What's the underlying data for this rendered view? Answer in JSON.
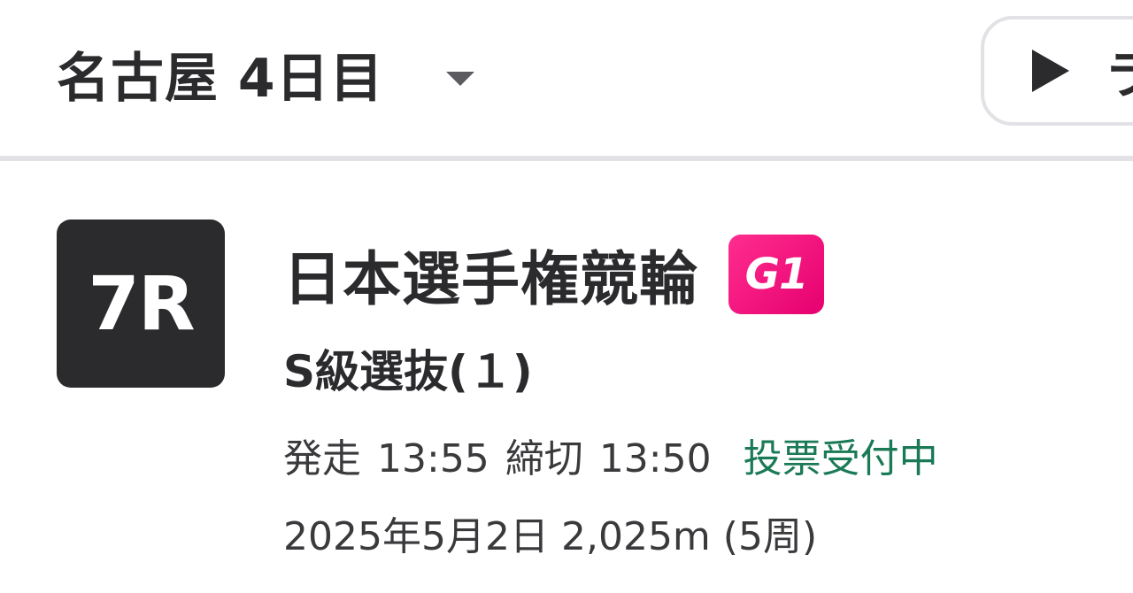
{
  "header": {
    "venue_title": "名古屋 4日目",
    "live_button_label": "ラ"
  },
  "race": {
    "number_badge": "7R",
    "title": "日本選手権競輪",
    "grade": "G1",
    "class": "S級選抜(１)",
    "start_label": "発走",
    "start_time": "13:55",
    "close_label": "締切",
    "close_time": "13:50",
    "status": "投票受付中",
    "date": "2025年5月2日",
    "distance": "2,025m",
    "laps": "(5周)"
  },
  "colors": {
    "text": "#2b2b2e",
    "badge_bg": "#2b2b2e",
    "grade_badge": "#e6006f",
    "status": "#1a7a56",
    "divider": "#e2e2e6"
  },
  "icons": {
    "caret": "caret-down-icon",
    "play": "play-icon"
  }
}
